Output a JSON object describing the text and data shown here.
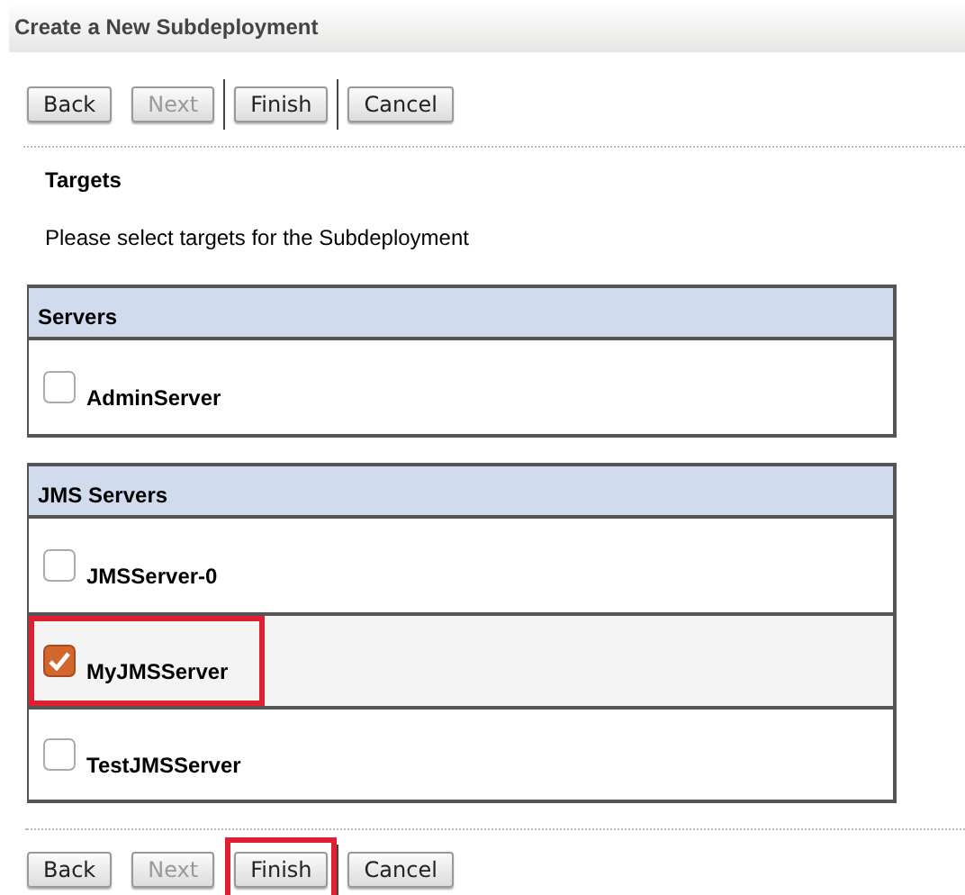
{
  "title": "Create a New Subdeployment",
  "top_buttons": [
    {
      "label": "Back",
      "disabled": false,
      "separator_before": false,
      "annotated": false
    },
    {
      "label": "Next",
      "disabled": true,
      "separator_before": false,
      "annotated": false
    },
    {
      "label": "Finish",
      "disabled": false,
      "separator_before": true,
      "annotated": false
    },
    {
      "label": "Cancel",
      "disabled": false,
      "separator_before": true,
      "annotated": false
    }
  ],
  "section_title": "Targets",
  "instruction": "Please select targets for the Subdeployment",
  "groups": [
    {
      "heading": "Servers",
      "items": [
        {
          "name": "AdminServer",
          "checked": false,
          "annotated": false
        }
      ]
    },
    {
      "heading": "JMS Servers",
      "items": [
        {
          "name": "JMSServer-0",
          "checked": false,
          "annotated": false
        },
        {
          "name": "MyJMSServer",
          "checked": true,
          "annotated": true
        },
        {
          "name": "TestJMSServer",
          "checked": false,
          "annotated": false
        }
      ]
    }
  ],
  "bottom_buttons": [
    {
      "label": "Back",
      "disabled": false,
      "separator_before": false,
      "annotated": false
    },
    {
      "label": "Next",
      "disabled": true,
      "separator_before": false,
      "annotated": false
    },
    {
      "label": "Finish",
      "disabled": false,
      "separator_before": false,
      "annotated": true
    },
    {
      "label": "Cancel",
      "disabled": false,
      "separator_before": true,
      "annotated": false
    }
  ]
}
